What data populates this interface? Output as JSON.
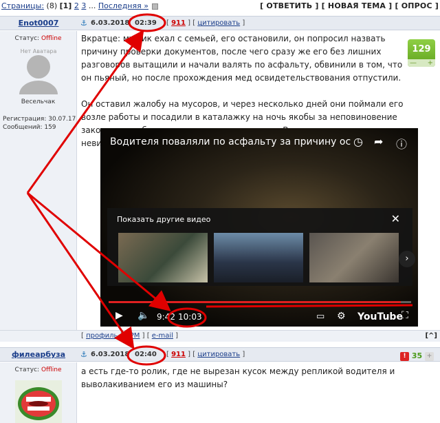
{
  "topbar": {
    "pages_label": "Страницы:",
    "pages_count": "(8)",
    "page_current": "[1]",
    "page_2": "2",
    "page_3": "3",
    "ellipsis": "...",
    "last_link": "Последняя »",
    "reply": "[ ОТВЕТИТЬ ]",
    "new_topic": "[ НОВАЯ ТЕМА ]",
    "poll": "[ ОПРОС ]"
  },
  "post1": {
    "author": "Enot0007",
    "status_label": "Статус:",
    "status_value": "Offline",
    "avatar_text": "Нет Аватара",
    "rank": "Весельчак",
    "registration": "Регистрация: 30.07.17",
    "messages": "Сообщений: 159",
    "date": "6.03.2018",
    "time": "02:39",
    "number": "911",
    "quote": "цитировать",
    "rating": "129",
    "rating_minus": "—",
    "rating_plus": "+",
    "text_p1": "Вкратце: мужик ехал с семьей, его остановили, он попросил назвать причину проверки документов, после чего сразу же его без лишних разговоров вытащили и начали валять по асфальту, обвинили в том, что он пьяный, но после прохождения мед освидетельствования отпустили.",
    "text_p2": "Он оставил жалобу на мусоров, и через несколько дней они поймали его возле работы и посадили в каталажку на ночь якобы за неповиновение законным требованиям сотрудника полиции. В итоге, суд признал его невиновным, а упырям грозит ст. 286 УК",
    "footer_profile": "профиль",
    "footer_pm": "PM",
    "footer_email": "e-mail",
    "footer_up": "[^]"
  },
  "video": {
    "title": "Водителя поваляли по асфальту за причину ост...",
    "more_videos": "Показать другие видео",
    "current_time": "9:42",
    "duration": "10:03",
    "progress_fraction": 0.965,
    "brand": "YouTube"
  },
  "post2": {
    "author": "филеарбуза",
    "status_label": "Статус:",
    "status_value": "Offline",
    "date": "6.03.2018",
    "time": "02:40",
    "number": "911",
    "quote": "цитировать",
    "rating": "35",
    "text": "а есть где-то ролик, где не вырезан кусок между репликой водителя и выволакиванием его из машины?"
  },
  "colors": {
    "accent_red": "#e00000",
    "link_blue": "#1a3d8a",
    "rating_green": "#6bb22a",
    "header_bg": "#e6eaf1"
  }
}
